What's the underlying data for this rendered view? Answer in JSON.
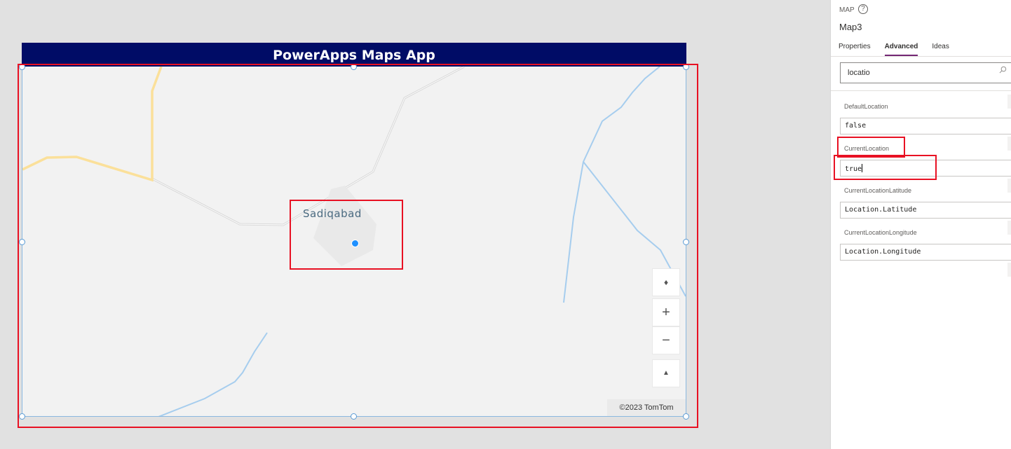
{
  "app": {
    "header_title": "PowerApps Maps App",
    "map_label": "Sadiqabad",
    "attribution": "©2023 TomTom"
  },
  "map_controls": {
    "compass_icon": "compass-icon",
    "zoom_in": "+",
    "zoom_out": "−",
    "pitch_icon": "pitch-icon"
  },
  "panel": {
    "control_type": "MAP",
    "control_name": "Map3",
    "tabs": [
      "Properties",
      "Advanced",
      "Ideas"
    ],
    "active_tab": "Advanced",
    "search_value": "locatio",
    "properties": [
      {
        "label": "DefaultLocation",
        "value": "false"
      },
      {
        "label": "CurrentLocation",
        "value": "true"
      },
      {
        "label": "CurrentLocationLatitude",
        "value": "Location.Latitude"
      },
      {
        "label": "CurrentLocationLongitude",
        "value": "Location.Longitude"
      }
    ]
  },
  "colors": {
    "header_bg": "#000c66",
    "highlight": "#e81123",
    "accent_tab": "#742774",
    "location_dot": "#1e90ff"
  }
}
